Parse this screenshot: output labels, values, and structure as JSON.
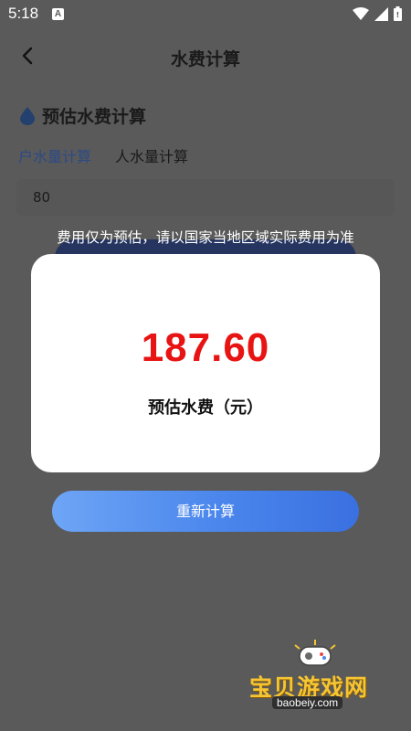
{
  "status_bar": {
    "time": "5:18",
    "app_icon": "A"
  },
  "header": {
    "title": "水费计算"
  },
  "section": {
    "title": "预估水费计算"
  },
  "tabs": [
    {
      "label": "户水量计算",
      "active": true
    },
    {
      "label": "人水量计算",
      "active": false
    }
  ],
  "input": {
    "value": "80"
  },
  "notice": "费用仅为预估，请以国家当地区域实际费用为准",
  "dialog": {
    "amount": "187.60",
    "label": "预估水费（元）"
  },
  "recalc_button": "重新计算",
  "watermark": {
    "text": "宝贝游戏网",
    "url": "baobeiy.com"
  },
  "colors": {
    "amount": "#e81414",
    "button_start": "#6ea5f6",
    "button_end": "#3a70e0",
    "overlay": "#5a5a5a"
  }
}
